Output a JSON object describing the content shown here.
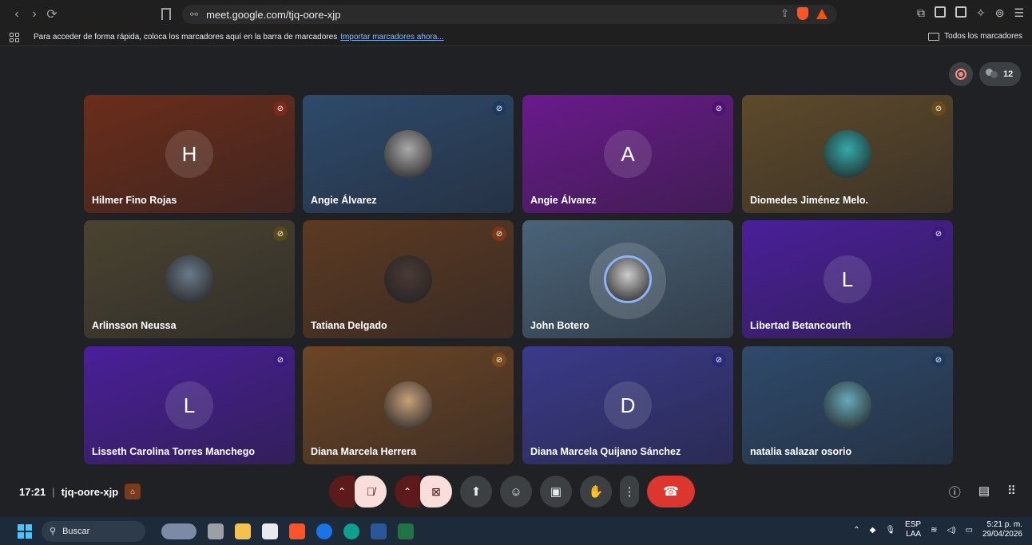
{
  "browser": {
    "url": "meet.google.com/tjq-oore-xjp",
    "bookmarks_hint": "Para acceder de forma rápida, coloca los marcadores aquí en la barra de marcadores",
    "bookmarks_link": "Importar marcadores ahora...",
    "all_bookmarks": "Todos los marcadores"
  },
  "meet": {
    "participant_count": "12",
    "tiles": [
      {
        "name": "Hilmer Fino Rojas",
        "initial": "H",
        "bg": "#6b2d1a"
      },
      {
        "name": "Angie Álvarez",
        "initial": "",
        "bg": "#2e4a6b"
      },
      {
        "name": "Angie Álvarez",
        "initial": "A",
        "bg": "#6a1a8c"
      },
      {
        "name": "Diomedes Jiménez Melo.",
        "initial": "",
        "bg": "#5e4a2a"
      },
      {
        "name": "Arlinsson Neussa",
        "initial": "",
        "bg": "#4a4330"
      },
      {
        "name": "Tatiana Delgado",
        "initial": "",
        "bg": "#5c3a22"
      },
      {
        "name": "John Botero",
        "initial": "",
        "bg": "#4a6378"
      },
      {
        "name": "Libertad Betancourth",
        "initial": "L",
        "bg": "#4a1f9a"
      },
      {
        "name": "Lisseth Carolina Torres Manchego",
        "initial": "L",
        "bg": "#4a1f9a"
      },
      {
        "name": "Diana Marcela Herrera",
        "initial": "",
        "bg": "#6b4525"
      },
      {
        "name": "Diana Marcela Quijano Sánchez",
        "initial": "D",
        "bg": "#3a3a8c"
      },
      {
        "name": "natalia salazar osorio",
        "initial": "",
        "bg": "#2e4a6b"
      }
    ],
    "time": "17:21",
    "meeting_code": "tjq-oore-xjp"
  },
  "taskbar": {
    "search": "Buscar",
    "lang_top": "ESP",
    "lang_bottom": "LAA",
    "clock_time": "5:21 p. m.",
    "clock_date": "29/04/2026"
  }
}
